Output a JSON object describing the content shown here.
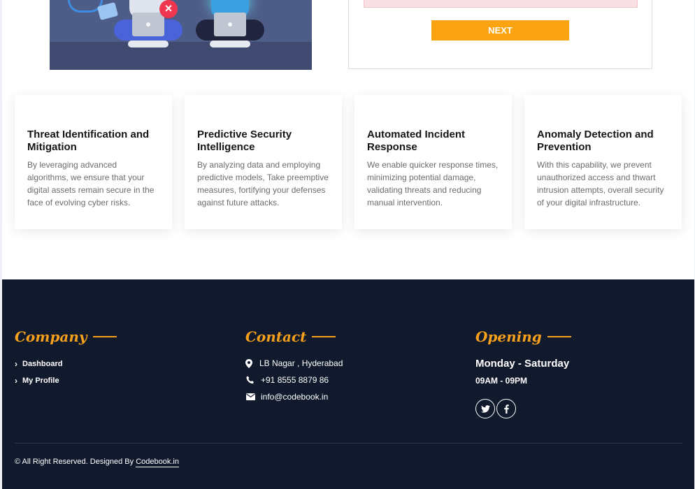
{
  "form": {
    "next_label": "NEXT"
  },
  "features": [
    {
      "title": "Threat Identification and Mitigation",
      "text": "By leveraging advanced algorithms, we ensure that your digital assets remain secure in the face of evolving cyber risks."
    },
    {
      "title": "Predictive Security Intelligence",
      "text": "By analyzing data and employing predictive models, Take preemptive measures, fortifying your defenses against future attacks."
    },
    {
      "title": "Automated Incident Response",
      "text": "We enable quicker response times, minimizing potential damage, validating threats and reducing manual intervention."
    },
    {
      "title": "Anomaly Detection and Prevention",
      "text": "With this capability, we prevent unauthorized access and thwart intrusion attempts, overall security of your digital infrastructure."
    }
  ],
  "footer": {
    "company": {
      "heading": "Company",
      "links": [
        "Dashboard",
        "My Profile"
      ]
    },
    "contact": {
      "heading": "Contact",
      "address": "LB Nagar , Hyderabad",
      "phone": "+91 8555 8879 86",
      "email": "info@codebook.in"
    },
    "opening": {
      "heading": "Opening",
      "days": "Monday - Saturday",
      "hours": "09AM - 09PM"
    },
    "social": [
      "twitter-icon",
      "facebook-icon"
    ],
    "copyright": {
      "text": "© All Right Reserved. Designed By ",
      "link": "Codebook.in"
    }
  },
  "colors": {
    "accent": "#fca311",
    "footer_bg": "#101a2c",
    "heading_accent": "#f7a01c"
  }
}
